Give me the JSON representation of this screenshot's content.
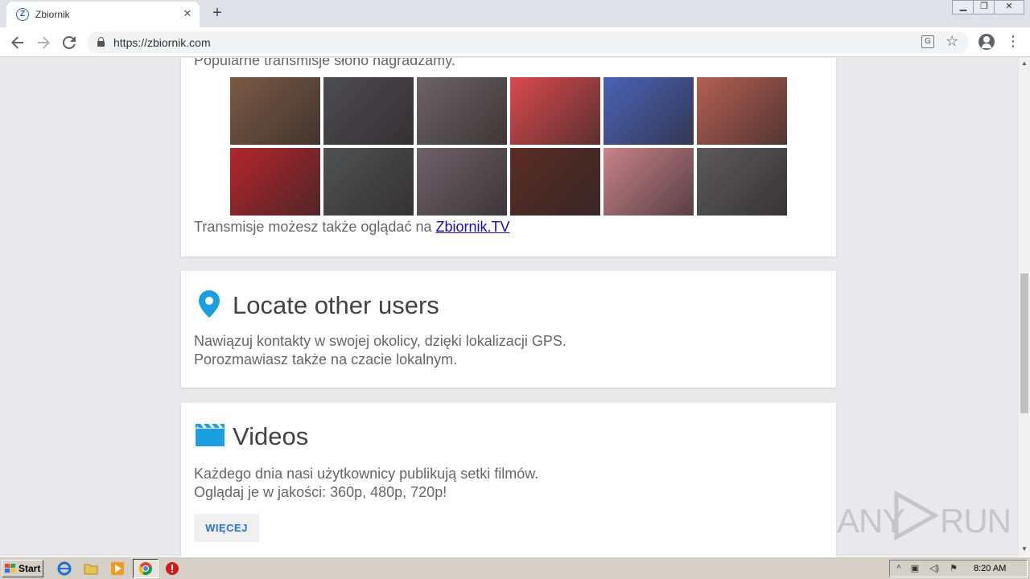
{
  "browser": {
    "tab_title": "Zbiornik",
    "tab_favicon_letter": "Z",
    "url": "https://zbiornik.com",
    "new_tab_label": "+",
    "close_tab_label": "✕"
  },
  "icons": {
    "back": "arrow-left-icon",
    "forward": "arrow-right-icon",
    "reload": "reload-icon",
    "lock": "lock-icon",
    "translate": "translate-icon",
    "bookmark": "star-icon",
    "account": "account-icon",
    "menu": "kebab-menu-icon",
    "locate": "location-pin-icon",
    "videos": "clapperboard-icon"
  },
  "colors": {
    "accent_icon": "#1a9fe0",
    "link": "#1a0dab",
    "button_text": "#2a6fd4",
    "page_bg": "#e9e9eb"
  },
  "transmisje": {
    "popular_text": "Popularne transmisje słono nagradzamy.",
    "watch_prefix": "Transmisje możesz także oglądać na ",
    "watch_link": "Zbiornik.TV",
    "thumbnails": [
      {
        "row": 1,
        "col": 1,
        "color": "#7b5a44"
      },
      {
        "row": 1,
        "col": 2,
        "color": "#4d4c50"
      },
      {
        "row": 1,
        "col": 3,
        "color": "#6c6466"
      },
      {
        "row": 1,
        "col": 4,
        "color": "#d84a4d"
      },
      {
        "row": 1,
        "col": 5,
        "color": "#4a63b8"
      },
      {
        "row": 1,
        "col": 6,
        "color": "#b45f52"
      },
      {
        "row": 2,
        "col": 1,
        "color": "#b3252b"
      },
      {
        "row": 2,
        "col": 2,
        "color": "#505253"
      },
      {
        "row": 2,
        "col": 3,
        "color": "#6e6268"
      },
      {
        "row": 2,
        "col": 4,
        "color": "#5a2d25"
      },
      {
        "row": 2,
        "col": 5,
        "color": "#c8828a"
      },
      {
        "row": 2,
        "col": 6,
        "color": "#5b5a5b"
      }
    ]
  },
  "locate": {
    "title": "Locate other users",
    "line1": "Nawiązuj kontakty w swojej okolicy, dzięki lokalizacji GPS.",
    "line2": "Porozmawiasz także na czacie lokalnym."
  },
  "videos": {
    "title": "Videos",
    "line1": "Każdego dnia nasi użytkownicy publikują setki filmów.",
    "line2": "Oglądaj je w jakości: 360p, 480p, 720p!",
    "more_button": "WIĘCEJ"
  },
  "watermark": {
    "left": "ANY",
    "right": "RUN"
  },
  "taskbar": {
    "start_label": "Start",
    "clock": "8:20 AM",
    "items": [
      "ie-icon",
      "folder-icon",
      "media-player-icon",
      "chrome-icon",
      "stop-icon"
    ]
  }
}
